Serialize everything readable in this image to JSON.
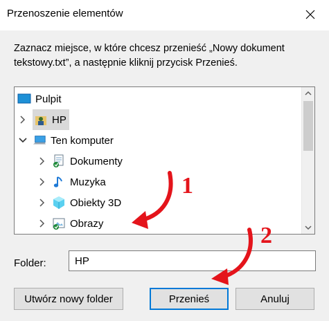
{
  "dialog": {
    "title": "Przenoszenie elementów",
    "instruction": "Zaznacz miejsce, w które chcesz przenieść „Nowy dokument tekstowy.txt”, a następnie kliknij przycisk Przenieś."
  },
  "tree": {
    "items": [
      {
        "label": "Pulpit",
        "icon": "desktop-icon",
        "expander": "none",
        "selected": false
      },
      {
        "label": "HP",
        "icon": "user-folder-icon",
        "expander": "collapsed",
        "selected": true
      },
      {
        "label": "Ten komputer",
        "icon": "computer-icon",
        "expander": "expanded",
        "selected": false
      },
      {
        "label": "Dokumenty",
        "icon": "documents-icon",
        "expander": "collapsed",
        "selected": false
      },
      {
        "label": "Muzyka",
        "icon": "music-icon",
        "expander": "collapsed",
        "selected": false
      },
      {
        "label": "Obiekty 3D",
        "icon": "3d-objects-icon",
        "expander": "collapsed",
        "selected": false
      },
      {
        "label": "Obrazy",
        "icon": "pictures-icon",
        "expander": "collapsed",
        "selected": false
      }
    ]
  },
  "folder": {
    "label": "Folder:",
    "value": "HP"
  },
  "buttons": {
    "new_folder": "Utwórz nowy folder",
    "move": "Przenieś",
    "cancel": "Anuluj"
  },
  "annotations": {
    "step1": "1",
    "step2": "2",
    "color": "#e4141b"
  },
  "colors": {
    "accent": "#0078d7",
    "selection": "#d9d9d9"
  }
}
